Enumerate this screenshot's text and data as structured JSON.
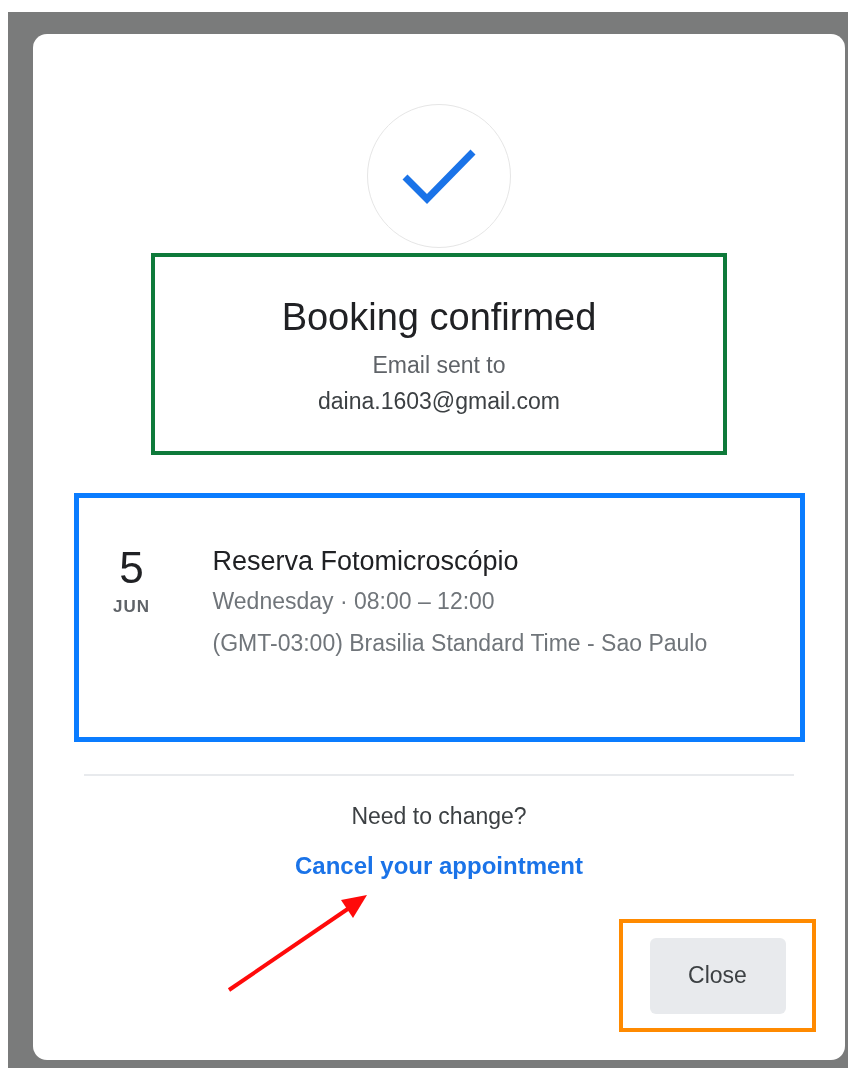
{
  "dialog": {
    "title": "Booking confirmed",
    "email_label": "Email sent to",
    "email": "daina.1603@gmail.com",
    "event": {
      "day": "5",
      "month": "JUN",
      "title": "Reserva Fotomicroscópio",
      "when": "Wednesday · 08:00 – 12:00",
      "timezone": "(GMT-03:00) Brasilia Standard Time - Sao Paulo"
    },
    "change_prompt": "Need to change?",
    "cancel_link": "Cancel your appointment",
    "close_button": "Close"
  }
}
